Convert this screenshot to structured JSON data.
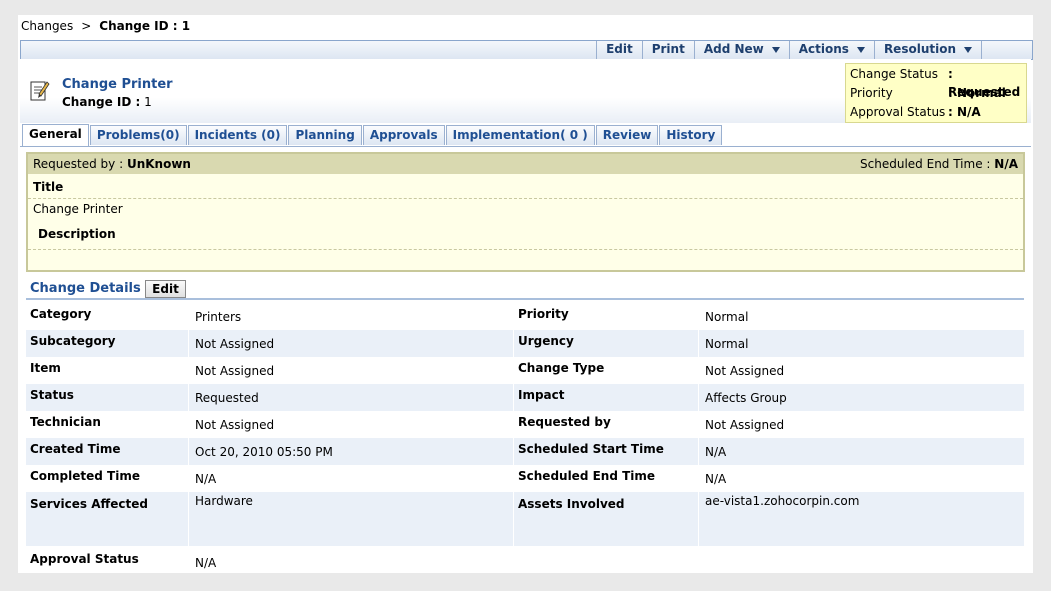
{
  "breadcrumb": {
    "parent": "Changes",
    "separator": ">",
    "current": "Change ID : 1"
  },
  "toolbar": {
    "edit": "Edit",
    "print": "Print",
    "add_new": "Add New",
    "actions": "Actions",
    "resolution": "Resolution"
  },
  "header": {
    "title": "Change Printer",
    "id_label": "Change ID :",
    "id_value": "1"
  },
  "status_box": {
    "change_status_label": "Change Status",
    "change_status_value": ": Requested",
    "priority_label": "Priority",
    "priority_value": ": Normal",
    "approval_label": "Approval Status",
    "approval_value": ": N/A"
  },
  "tabs": [
    "General",
    "Problems(0)",
    "Incidents (0)",
    "Planning",
    "Approvals",
    "Implementation( 0 )",
    "Review",
    "History"
  ],
  "request_panel": {
    "requested_by_label": "Requested by :",
    "requested_by_value": "UnKnown",
    "sched_end_label": "Scheduled End Time :",
    "sched_end_value": "N/A",
    "title_label": "Title",
    "title_value": "Change Printer",
    "description_label": "Description"
  },
  "change_details": {
    "heading": "Change Details",
    "edit_label": "Edit",
    "rows": [
      {
        "l1": "Category",
        "v1": "Printers",
        "l2": "Priority",
        "v2": "Normal"
      },
      {
        "l1": "Subcategory",
        "v1": "Not Assigned",
        "l2": "Urgency",
        "v2": "Normal"
      },
      {
        "l1": "Item",
        "v1": "Not Assigned",
        "l2": "Change Type",
        "v2": "Not Assigned"
      },
      {
        "l1": "Status",
        "v1": "Requested",
        "l2": "Impact",
        "v2": "Affects Group"
      },
      {
        "l1": "Technician",
        "v1": "Not Assigned",
        "l2": "Requested by",
        "v2": "Not Assigned"
      },
      {
        "l1": "Created Time",
        "v1": "Oct 20, 2010 05:50 PM",
        "l2": "Scheduled Start Time",
        "v2": "N/A"
      },
      {
        "l1": "Completed Time",
        "v1": "N/A",
        "l2": "Scheduled End Time",
        "v2": "N/A"
      },
      {
        "l1": "Services Affected",
        "v1": "Hardware",
        "l2": "Assets Involved",
        "v2": "ae-vista1.zohocorpin.com"
      }
    ],
    "approval_label": "Approval Status",
    "approval_value": "N/A"
  },
  "colors": {
    "link": "#1f4f93",
    "status_box_bg": "#ffffc6",
    "panel_bar": "#d9d9b0",
    "row_alt": "#eaf0f8"
  },
  "icons": {
    "document": "edit-document-icon",
    "dropdown": "caret-down-icon"
  }
}
